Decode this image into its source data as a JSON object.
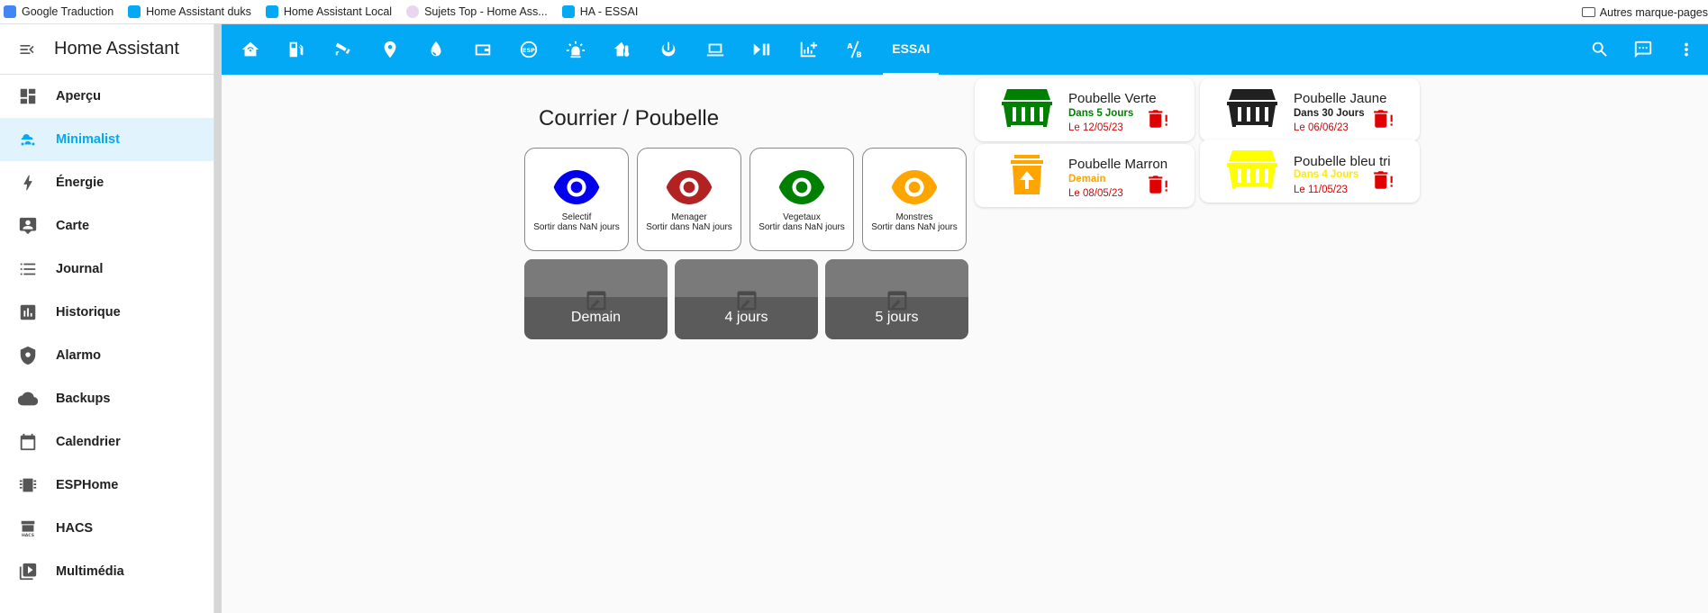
{
  "browser": {
    "bookmarks": [
      {
        "label": "Google Traduction",
        "color": "#4285f4"
      },
      {
        "label": "Home Assistant duks",
        "color": "#03a9f4"
      },
      {
        "label": "Home Assistant Local",
        "color": "#03a9f4"
      },
      {
        "label": "Sujets Top - Home Ass...",
        "color": "#c9a0dc"
      },
      {
        "label": "HA - ESSAI",
        "color": "#03a9f4"
      }
    ],
    "other_bookmarks": "Autres marque-pages"
  },
  "sidebar": {
    "title": "Home Assistant",
    "items": [
      {
        "label": "Aperçu",
        "icon": "dashboard-icon"
      },
      {
        "label": "Minimalist",
        "icon": "person-cloud-icon",
        "active": true
      },
      {
        "label": "Énergie",
        "icon": "lightning-icon"
      },
      {
        "label": "Carte",
        "icon": "map-account-icon"
      },
      {
        "label": "Journal",
        "icon": "list-icon"
      },
      {
        "label": "Historique",
        "icon": "chart-box-icon"
      },
      {
        "label": "Alarmo",
        "icon": "shield-icon"
      },
      {
        "label": "Backups",
        "icon": "cloud-icon"
      },
      {
        "label": "Calendrier",
        "icon": "calendar-icon"
      },
      {
        "label": "ESPHome",
        "icon": "chip-icon"
      },
      {
        "label": "HACS",
        "icon": "hacs-icon"
      },
      {
        "label": "Multimédia",
        "icon": "play-box-icon"
      }
    ]
  },
  "topbar": {
    "view_icons": [
      "home-wifi-icon",
      "fuel-icon",
      "cctv-icon",
      "map-marker-icon",
      "water-icon",
      "wallet-icon",
      "esp-icon",
      "alarm-light-icon",
      "home-thermometer-icon",
      "power-icon",
      "laptop-icon",
      "play-pause-icon",
      "chart-plus-icon",
      "ab-testing-icon"
    ],
    "active_tab": "ESSAI",
    "actions": [
      "search-icon",
      "assist-icon",
      "more-vert-icon"
    ],
    "accent": "#03a9f4"
  },
  "main": {
    "title": "Courrier / Poubelle",
    "eye_cards": [
      {
        "name": "Selectif",
        "sub": "Sortir dans NaN jours",
        "color": "#0000ee"
      },
      {
        "name": "Menager",
        "sub": "Sortir dans NaN jours",
        "color": "#b22222"
      },
      {
        "name": "Vegetaux",
        "sub": "Sortir dans NaN jours",
        "color": "#008000"
      },
      {
        "name": "Monstres",
        "sub": "Sortir dans NaN jours",
        "color": "#ffa500"
      }
    ],
    "day_cards": [
      {
        "label": "Demain"
      },
      {
        "label": "4 jours"
      },
      {
        "label": "5 jours"
      }
    ],
    "bins": [
      {
        "name": "Poubelle Verte",
        "when": "Dans 5 Jours",
        "when_color": "#008000",
        "date": "Le 12/05/23",
        "color": "#008000",
        "icon": "dumpster-icon"
      },
      {
        "name": "Poubelle Jaune",
        "when": "Dans 30 Jours",
        "when_color": "#212121",
        "date": "Le 06/06/23",
        "color": "#212121",
        "icon": "dumpster-icon"
      },
      {
        "name": "Poubelle Marron",
        "when": "Demain",
        "when_color": "#ffa500",
        "date": "Le 08/05/23",
        "color": "#ffa500",
        "icon": "recycle-bin-icon"
      },
      {
        "name": "Poubelle bleu tri",
        "when": "Dans 4 Jours",
        "when_color": "#ffea00",
        "date": "Le 11/05/23",
        "color": "#ffff00",
        "icon": "dumpster-icon"
      }
    ]
  }
}
